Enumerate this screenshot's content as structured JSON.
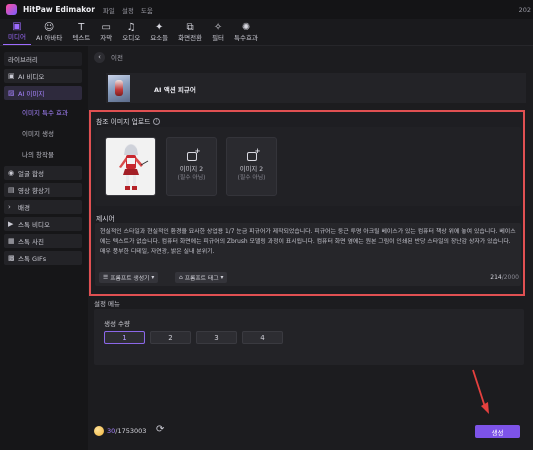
{
  "app": {
    "name": "HitPaw Edimakor",
    "menu": [
      "파일",
      "설정",
      "도움"
    ],
    "year_fragment": "202"
  },
  "toolbar": {
    "items": [
      {
        "label": "미디어",
        "icon": "media-icon"
      },
      {
        "label": "AI 아바타",
        "icon": "avatar-icon"
      },
      {
        "label": "텍스트",
        "icon": "text-icon"
      },
      {
        "label": "자막",
        "icon": "subtitle-icon"
      },
      {
        "label": "오디오",
        "icon": "audio-icon"
      },
      {
        "label": "요소들",
        "icon": "elements-icon"
      },
      {
        "label": "화면전환",
        "icon": "transition-icon"
      },
      {
        "label": "필터",
        "icon": "filter-icon"
      },
      {
        "label": "특수효과",
        "icon": "effects-icon"
      }
    ],
    "active_index": 0
  },
  "sidebar": {
    "items": [
      {
        "label": "라이브러리",
        "icon": ""
      },
      {
        "label": "AI 비디오",
        "icon": "video-icon"
      },
      {
        "label": "AI 이미지",
        "icon": "image-icon"
      },
      {
        "label": "이미지 특수 효과",
        "icon": ""
      },
      {
        "label": "이미지 생성",
        "icon": ""
      },
      {
        "label": "나의 창작물",
        "icon": ""
      },
      {
        "label": "얼굴 합성",
        "icon": "face-icon"
      },
      {
        "label": "영상 향상기",
        "icon": "enhance-icon"
      },
      {
        "label": "배경",
        "icon": "chevron-icon"
      },
      {
        "label": "스톡 비디오",
        "icon": "stock-video-icon"
      },
      {
        "label": "스톡 사진",
        "icon": "stock-photo-icon"
      },
      {
        "label": "스톡 GIFs",
        "icon": "gif-icon"
      }
    ]
  },
  "main": {
    "back_label": "이전",
    "effect_title": "AI 액션 피규어",
    "ref_title": "참조 이미지 업로드",
    "slots": [
      {
        "title": "이미지 2",
        "note": "(필수 아님)"
      },
      {
        "title": "이미지 2",
        "note": "(필수 아님)"
      }
    ],
    "prompt_title": "제시어",
    "prompt_text": "현실적인 스타일과 현실적인 환경을 묘사한 상업용 1/7 눈금 피규어가 제작되었습니다. 피규어는 둥근 투명 아크릴 베이스가 있는 컴퓨터 책상 위에 놓여 있습니다. 베이스에는 텍스트가 없습니다. 컴퓨터 화면에는 피규어의 Zbrush 모델링 과정이 표시됩니다. 컴퓨터 화면 옆에는 원본 그림이 인쇄된 반당 스타일의 장난감 상자가 있습니다. 매우 풍부한 디테일, 자연광, 밝은 실내 분위기.",
    "chip_generator": "프롬프트 생성기",
    "chip_tags": "프롬프트 태그",
    "count": "214",
    "count_max": "/2000"
  },
  "settings": {
    "section_title": "설정 메뉴",
    "group_label": "생성 수량",
    "options": [
      "1",
      "2",
      "3",
      "4"
    ],
    "selected": "1"
  },
  "bottom": {
    "credits_used": "30",
    "credits_total": "/1753003",
    "generate_label": "생성"
  },
  "colors": {
    "accent": "#7d53e8",
    "highlight_border": "#e05052",
    "arrow": "#e5403e"
  }
}
